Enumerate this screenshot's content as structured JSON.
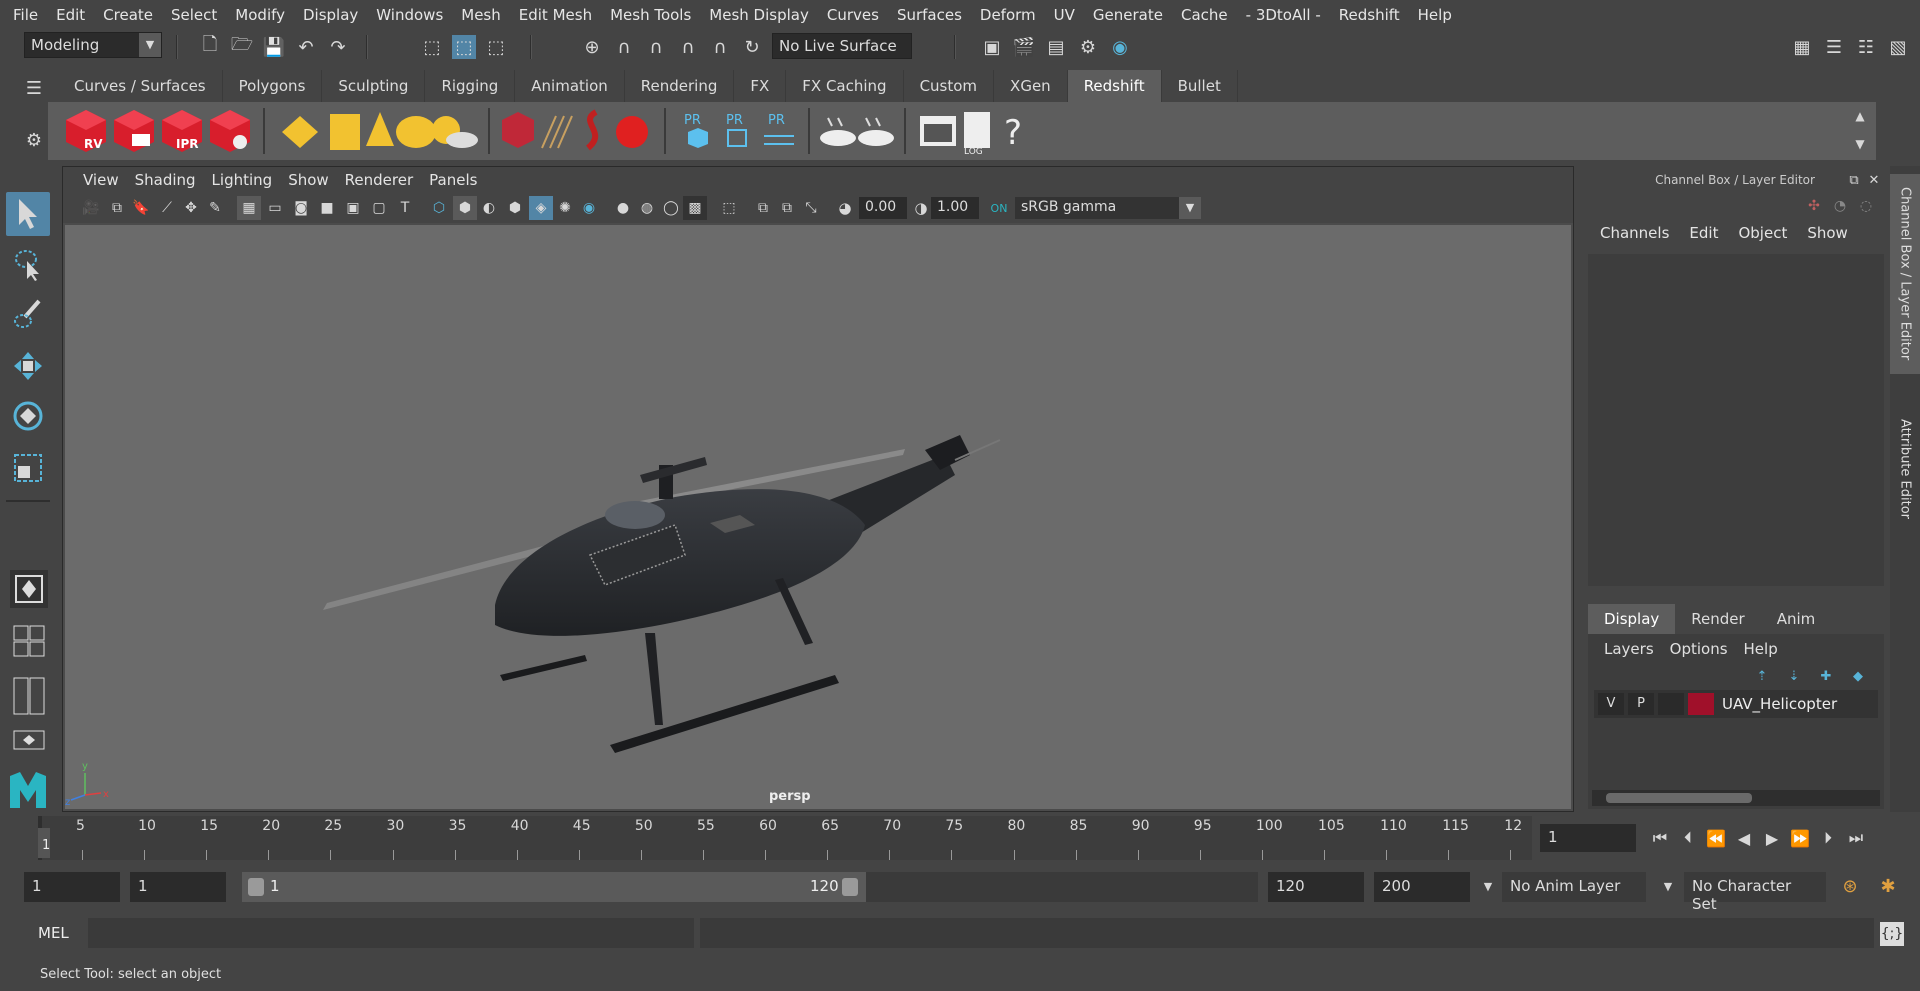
{
  "menu": [
    "File",
    "Edit",
    "Create",
    "Select",
    "Modify",
    "Display",
    "Windows",
    "Mesh",
    "Edit Mesh",
    "Mesh Tools",
    "Mesh Display",
    "Curves",
    "Surfaces",
    "Deform",
    "UV",
    "Generate",
    "Cache",
    "- 3DtoAll -",
    "Redshift",
    "Help"
  ],
  "statusline": {
    "workspace": "Modeling",
    "live_surface": "No Live Surface"
  },
  "shelf": {
    "tabs": [
      "Curves / Surfaces",
      "Polygons",
      "Sculpting",
      "Rigging",
      "Animation",
      "Rendering",
      "FX",
      "FX Caching",
      "Custom",
      "XGen",
      "Redshift",
      "Bullet"
    ],
    "active_tab": "Redshift",
    "icon_labels": {
      "rv": "RV",
      "ipr": "IPR",
      "pr1": "PR",
      "pr2": "PR",
      "pr3": "PR",
      "log": "LOG",
      "help": "?"
    }
  },
  "viewport": {
    "menu": [
      "View",
      "Shading",
      "Lighting",
      "Show",
      "Renderer",
      "Panels"
    ],
    "exposure": "0.00",
    "gamma": "1.00",
    "color_space": "sRGB gamma",
    "camera": "persp",
    "axis": {
      "x": "x",
      "y": "y",
      "z": "z"
    }
  },
  "channel_box": {
    "title": "Channel Box / Layer Editor",
    "menu": [
      "Channels",
      "Edit",
      "Object",
      "Show"
    ]
  },
  "layer_editor": {
    "tabs": [
      "Display",
      "Render",
      "Anim"
    ],
    "active_tab": "Display",
    "menu": [
      "Layers",
      "Options",
      "Help"
    ],
    "layer": {
      "v": "V",
      "p": "P",
      "name": "UAV_Helicopter",
      "color": "#a0102a"
    }
  },
  "side_tabs": [
    "Channel Box / Layer Editor",
    "Attribute Editor"
  ],
  "timeline": {
    "ticks": [
      "5",
      "10",
      "15",
      "20",
      "25",
      "30",
      "35",
      "40",
      "45",
      "50",
      "55",
      "60",
      "65",
      "70",
      "75",
      "80",
      "85",
      "90",
      "95",
      "100",
      "105",
      "110",
      "115",
      "12"
    ],
    "current_frame_marker": "1",
    "current_frame": "1"
  },
  "range": {
    "start": "1",
    "playback_start": "1",
    "range_start_label": "1",
    "range_end_label": "120",
    "playback_end": "120",
    "end": "200",
    "anim_layer": "No Anim Layer",
    "character_set": "No Character Set"
  },
  "command": {
    "language": "MEL"
  },
  "help_line": "Select Tool: select an object",
  "colors": {
    "accent": "#5285a6",
    "redshift_red": "#e02030",
    "highlight_yellow": "#f2c230"
  }
}
